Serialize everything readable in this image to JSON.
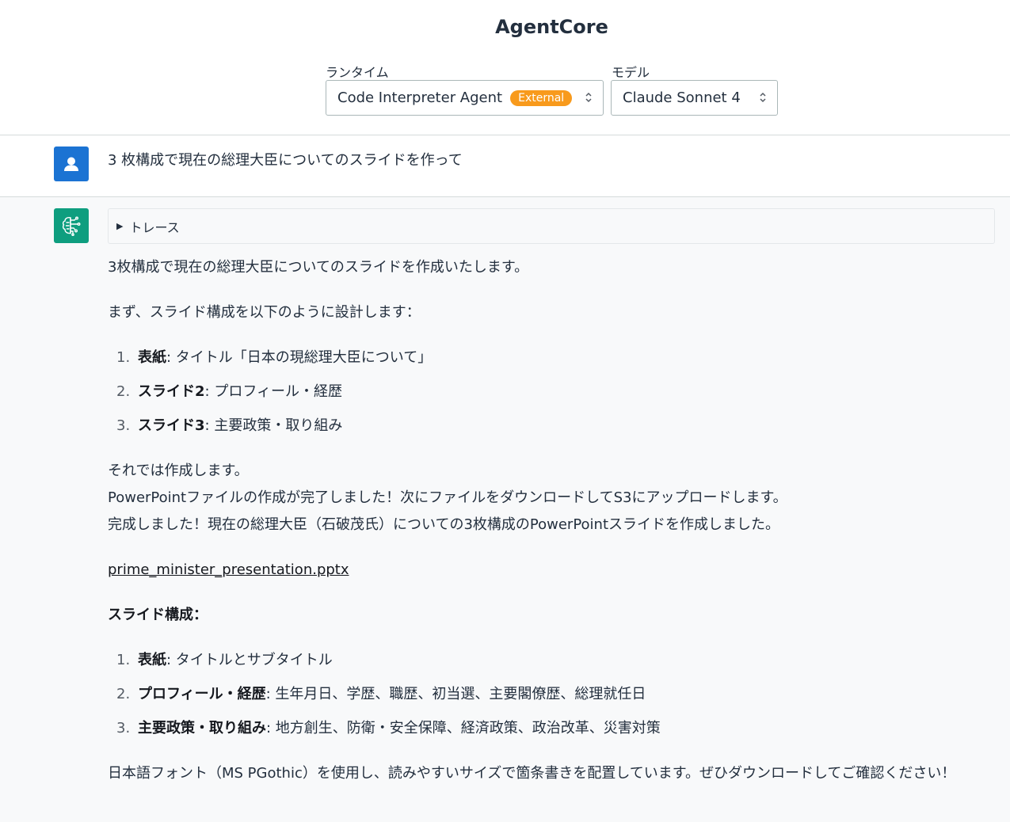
{
  "header": {
    "title": "AgentCore",
    "runtime_label": "ランタイム",
    "runtime_value": "Code Interpreter Agent",
    "runtime_badge": "External",
    "model_label": "モデル",
    "model_value": "Claude Sonnet 4"
  },
  "user_message": {
    "avatar_icon": "user-icon",
    "text": "3 枚構成で現在の総理大臣についてのスライドを作って"
  },
  "bot_message": {
    "avatar_icon": "brain-circuit-icon",
    "trace_label": "トレース",
    "intro": "3枚構成で現在の総理大臣についてのスライドを作成いたします。",
    "plan_intro": "まず、スライド構成を以下のように設計します：",
    "plan": [
      {
        "num": "1.",
        "bold": "表紙",
        "rest": ": タイトル「日本の現総理大臣について」"
      },
      {
        "num": "2.",
        "bold": "スライド2",
        "rest": ": プロフィール・経歴"
      },
      {
        "num": "3.",
        "bold": "スライド3",
        "rest": ": 主要政策・取り組み"
      }
    ],
    "status_1": "それでは作成します。",
    "status_2": "PowerPointファイルの作成が完了しました！次にファイルをダウンロードしてS3にアップロードします。",
    "status_3": "完成しました！現在の総理大臣（石破茂氏）についての3枚構成のPowerPointスライドを作成しました。",
    "file_link": "prime_minister_presentation.pptx",
    "structure_heading": "スライド構成：",
    "structure": [
      {
        "num": "1.",
        "bold": "表紙",
        "rest": ": タイトルとサブタイトル"
      },
      {
        "num": "2.",
        "bold": "プロフィール・経歴",
        "rest": ": 生年月日、学歴、職歴、初当選、主要閣僚歴、総理就任日"
      },
      {
        "num": "3.",
        "bold": "主要政策・取り組み",
        "rest": ": 地方創生、防衛・安全保障、経済政策、政治改革、災害対策"
      }
    ],
    "closing": "日本語フォント（MS PGothic）を使用し、読みやすいサイズで箇条書きを配置しています。ぜひダウンロードしてご確認ください！"
  },
  "colors": {
    "badge": "#f89a1c",
    "user_avatar": "#1b73d3",
    "bot_avatar": "#0e9e7f"
  }
}
